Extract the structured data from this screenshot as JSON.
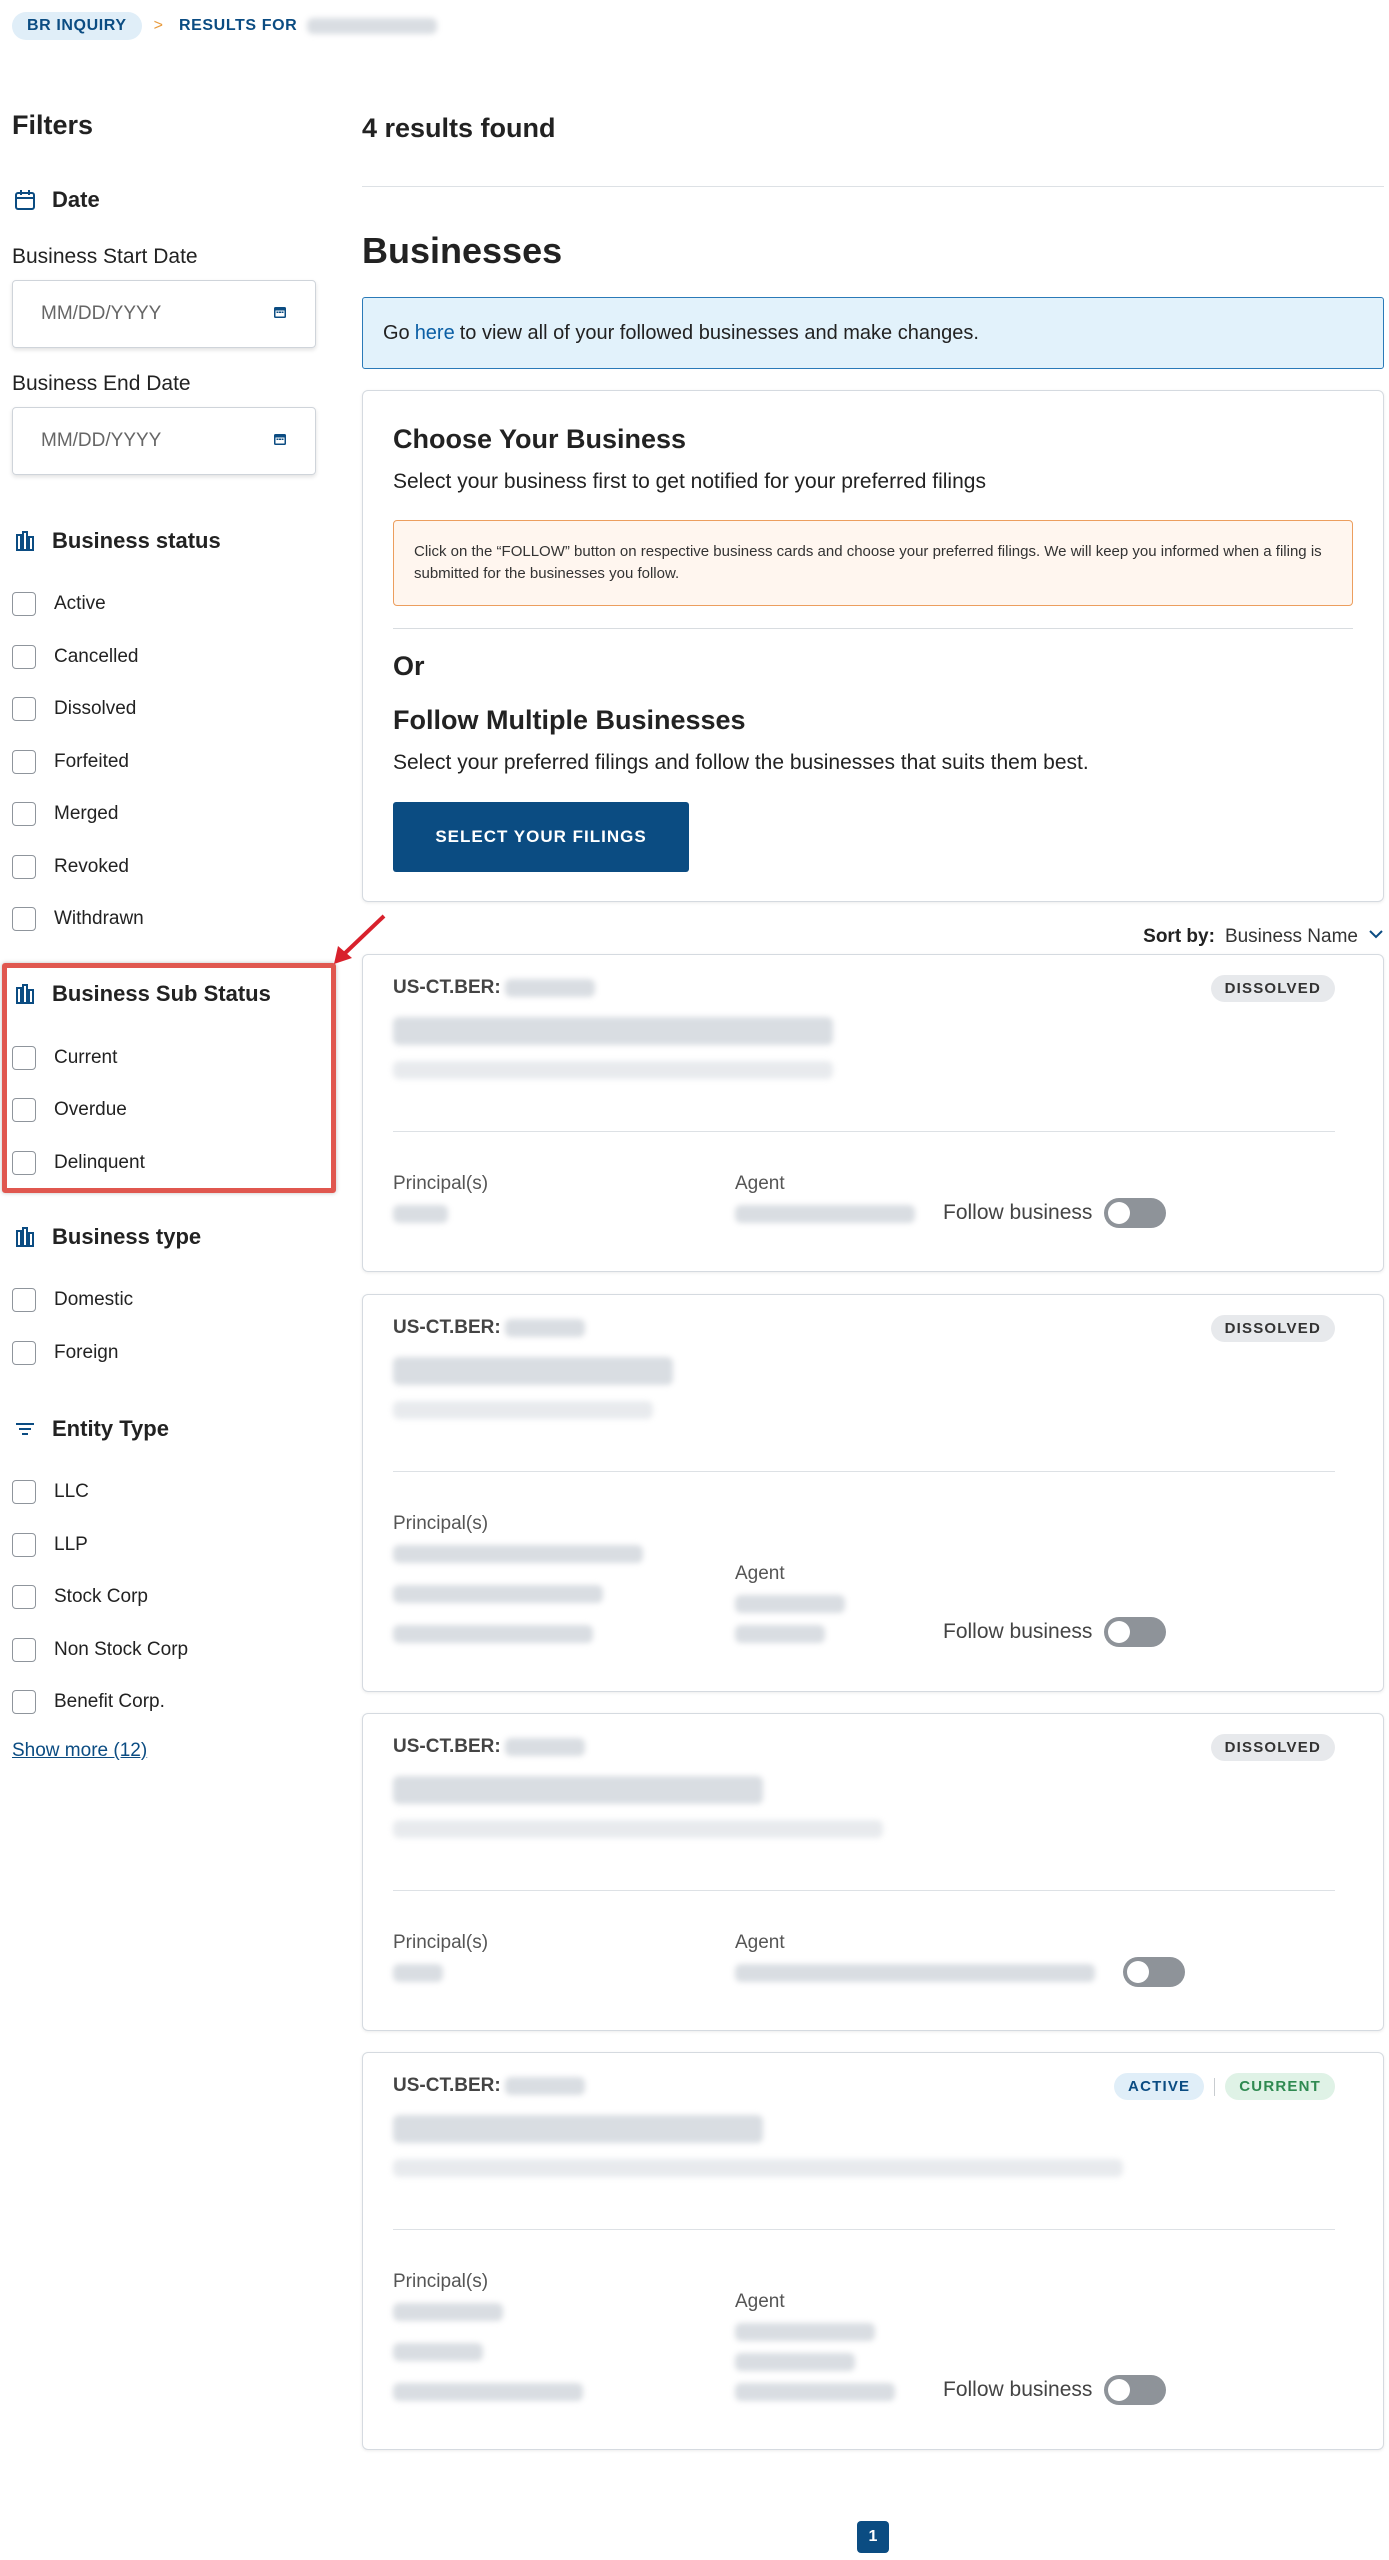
{
  "breadcrumb": {
    "home": "BR INQUIRY",
    "separator": ">",
    "current": "RESULTS FOR"
  },
  "filters": {
    "title": "Filters",
    "date": {
      "heading": "Date",
      "icon": "calendar-icon",
      "start_label": "Business Start Date",
      "start_placeholder": "MM/DD/YYYY",
      "end_label": "Business End Date",
      "end_placeholder": "MM/DD/YYYY"
    },
    "business_status": {
      "heading": "Business status",
      "icon": "building-icon",
      "options": [
        "Active",
        "Cancelled",
        "Dissolved",
        "Forfeited",
        "Merged",
        "Revoked",
        "Withdrawn"
      ]
    },
    "business_sub_status": {
      "heading": "Business Sub Status",
      "icon": "building-icon",
      "options": [
        "Current",
        "Overdue",
        "Delinquent"
      ]
    },
    "business_type": {
      "heading": "Business type",
      "icon": "building-icon",
      "options": [
        "Domestic",
        "Foreign"
      ]
    },
    "entity_type": {
      "heading": "Entity Type",
      "icon": "filter-lines-icon",
      "options": [
        "LLC",
        "LLP",
        "Stock Corp",
        "Non Stock Corp",
        "Benefit Corp."
      ],
      "show_more": "Show more (12)"
    }
  },
  "main": {
    "results_count": "4 results found",
    "section_title": "Businesses",
    "info": {
      "before": "Go",
      "link": "here",
      "after": "to view all of your followed businesses and make changes."
    },
    "choose": {
      "title": "Choose Your Business",
      "subtitle": "Select your business first to get notified for your preferred filings",
      "notice": "Click on the “FOLLOW” button on respective business cards and choose your preferred filings. We will keep you informed when a filing is submitted for the businesses you follow.",
      "or": "Or",
      "multi_title": "Follow Multiple Businesses",
      "multi_subtitle": "Select your preferred filings and follow the businesses that suits them best.",
      "button": "SELECT YOUR FILINGS"
    },
    "sort": {
      "label": "Sort by:",
      "value": "Business Name"
    },
    "cards": [
      {
        "id_prefix": "US-CT.BER:",
        "badges": [
          "DISSOLVED"
        ],
        "principal_label": "Principal(s)",
        "agent_label": "Agent",
        "follow_label": "Follow business",
        "following": false
      },
      {
        "id_prefix": "US-CT.BER:",
        "badges": [
          "DISSOLVED"
        ],
        "principal_label": "Principal(s)",
        "agent_label": "Agent",
        "follow_label": "Follow business",
        "following": false
      },
      {
        "id_prefix": "US-CT.BER:",
        "badges": [
          "DISSOLVED"
        ],
        "principal_label": "Principal(s)",
        "agent_label": "Agent",
        "follow_label": "",
        "following": false
      },
      {
        "id_prefix": "US-CT.BER:",
        "badges": [
          "ACTIVE",
          "CURRENT"
        ],
        "principal_label": "Principal(s)",
        "agent_label": "Agent",
        "follow_label": "Follow business",
        "following": false
      }
    ],
    "pagination": {
      "current_page": "1"
    }
  },
  "colors": {
    "brand": "#0b4c82",
    "highlight": "#e0574f",
    "info_bg": "#e2f2fb",
    "notice_border": "#ec9e5e"
  }
}
